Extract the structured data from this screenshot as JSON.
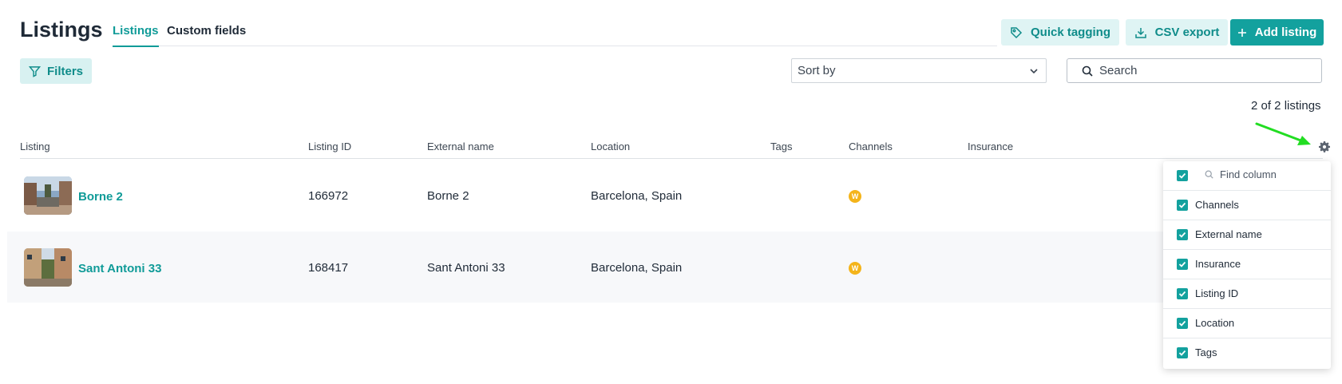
{
  "page": {
    "title": "Listings"
  },
  "tabs": [
    {
      "label": "Listings",
      "active": true
    },
    {
      "label": "Custom fields",
      "active": false
    }
  ],
  "actions": {
    "quick_tagging": "Quick tagging",
    "csv_export": "CSV export",
    "add_listing": "Add listing"
  },
  "toolbar": {
    "filters": "Filters",
    "sort_by": "Sort by",
    "search_placeholder": "Search"
  },
  "count_text": "2 of 2 listings",
  "table": {
    "columns": [
      "Listing",
      "Listing ID",
      "External name",
      "Location",
      "Tags",
      "Channels",
      "Insurance"
    ],
    "rows": [
      {
        "name": "Borne 2",
        "id": "166972",
        "external_name": "Borne 2",
        "location": "Barcelona, Spain",
        "channel": "W"
      },
      {
        "name": "Sant Antoni 33",
        "id": "168417",
        "external_name": "Sant Antoni 33",
        "location": "Barcelona, Spain",
        "channel": "W"
      }
    ]
  },
  "column_chooser": {
    "find_placeholder": "Find column",
    "items": [
      "Channels",
      "External name",
      "Insurance",
      "Listing ID",
      "Location",
      "Tags"
    ]
  },
  "colors": {
    "accent": "#13a19e",
    "accent_soft": "#dff4f4",
    "channel_badge": "#f4b41a",
    "annotation_arrow": "#22dd22"
  }
}
